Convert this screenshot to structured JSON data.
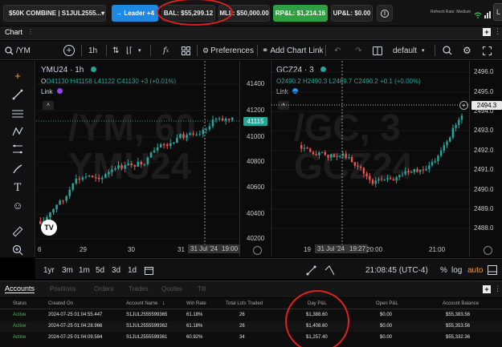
{
  "topbar": {
    "account_combo": "$50K COMBINE | S1JUL2555...",
    "leader_btn": "→ Leader +4",
    "balance": "BAL: $55,299.12",
    "mll": "MLL: $50,000.00",
    "rpl": "RP&L: $1,214.16",
    "upl": "UP&L: $0.00",
    "refresh_label": "Refresh Rate: Medium",
    "colors": {
      "leader": "#1e88e5",
      "rpl": "#2ea043",
      "annotation": "#e02020"
    }
  },
  "chart_tab": {
    "label": "Chart"
  },
  "toolbar": {
    "symbol": "/YM",
    "interval": "1h",
    "preferences": "Preferences",
    "add_chart_link": "Add Chart Link",
    "layout": "default"
  },
  "pane_left": {
    "title": "YMU24 · 1h",
    "watermark_1": "/YM, 60",
    "watermark_2": "YMU24",
    "ohlc": {
      "o": "O41130",
      "h": "H41158",
      "l": "L41122",
      "c": "C41130",
      "chg": "+3 (+0.01%)"
    },
    "link_label": "Link",
    "price_badge": "41115",
    "y_ticks": [
      "41400",
      "41200",
      "41000",
      "40800",
      "40600",
      "40400",
      "40200"
    ],
    "x_ticks": [
      "6",
      "29",
      "30",
      "31",
      "31 Jul '24",
      "19:00"
    ],
    "logo": "TV"
  },
  "pane_right": {
    "title": "GCZ24 · 3",
    "watermark_1": "/GC, 3",
    "watermark_2": "GCZ24",
    "ohlc": {
      "o": "O2490.2",
      "h": "H2490.3",
      "l": "L2489.7",
      "c": "C2490.2",
      "chg": "+0.1 (+0.00%)"
    },
    "link_label": "Link",
    "price_badge": "2494.3",
    "y_ticks": [
      "2496.0",
      "2495.0",
      "2494.0",
      "2493.0",
      "2492.0",
      "2491.0",
      "2490.0",
      "2489.0",
      "2488.0"
    ],
    "x_ticks": [
      "19",
      "31 Jul '24",
      "19:27",
      "20:00",
      "21:00"
    ]
  },
  "rangebar": {
    "ranges": [
      "1yr",
      "3m",
      "1m",
      "5d",
      "3d",
      "1d"
    ],
    "clock": "21:08:45 (UTC-4)",
    "pct": "%",
    "log": "log",
    "auto": "auto"
  },
  "bottom_tabs": [
    "Accounts",
    "Positions",
    "Orders",
    "Trades",
    "Quotes",
    "Tilt"
  ],
  "table": {
    "headers": [
      "Status",
      "Created On",
      "Account Name",
      "Win Rate",
      "Total Lots Traded",
      "Day P&L",
      "Open P&L",
      "Account Balance"
    ],
    "rows": [
      [
        "Active",
        "2024-07-25 01:04:55.447",
        "S1JUL2555599365",
        "61.18%",
        "26",
        "$1,388.60",
        "$0.00",
        "$55,383.56"
      ],
      [
        "Active",
        "2024-07-25 01:04:28.966",
        "S1JUL2555599362",
        "61.18%",
        "26",
        "$1,408.60",
        "$0.00",
        "$55,353.56"
      ],
      [
        "Active",
        "2024-07-25 01:04:09.584",
        "S1JUL2555599361",
        "60.92%",
        "34",
        "$1,257.40",
        "$0.00",
        "$55,332.36"
      ]
    ]
  }
}
